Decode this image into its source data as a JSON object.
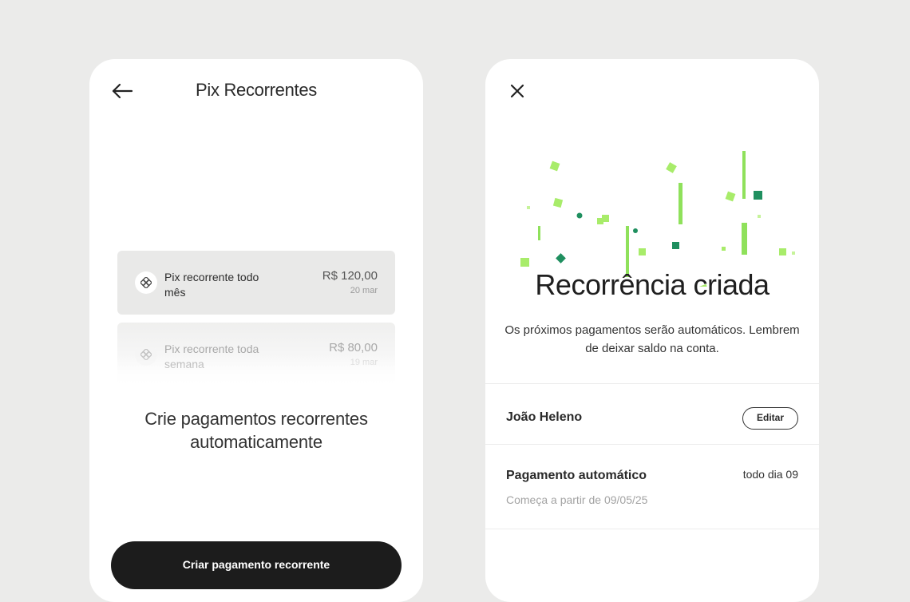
{
  "left_screen": {
    "title": "Pix Recorrentes",
    "back_icon": "arrow-left-icon",
    "cards": [
      {
        "title": "Pix recorrente todo mês",
        "amount": "R$ 120,00",
        "date": "20 mar",
        "icon": "pix-icon"
      },
      {
        "title": "Pix recorrente toda semana",
        "amount": "R$ 80,00",
        "date": "19 mar",
        "icon": "pix-icon"
      }
    ],
    "headline": "Crie pagamentos recorrentes automaticamente",
    "cta_label": "Criar pagamento recorrente"
  },
  "right_screen": {
    "close_icon": "close-icon",
    "title": "Recorrência criada",
    "subtitle": "Os próximos pagamentos serão automáticos. Lembrem de deixar saldo na conta.",
    "contact": {
      "name": "João Heleno",
      "edit_label": "Editar"
    },
    "payment": {
      "label": "Pagamento automático",
      "frequency": "todo dia 09",
      "start": "Começa a partir de 09/05/25"
    }
  },
  "colors": {
    "background": "#ebebea",
    "cta": "#1c1c1c",
    "confetti_light": "#a8ec6a",
    "confetti_lime": "#8fe15b",
    "confetti_dark": "#1f8f5f"
  }
}
